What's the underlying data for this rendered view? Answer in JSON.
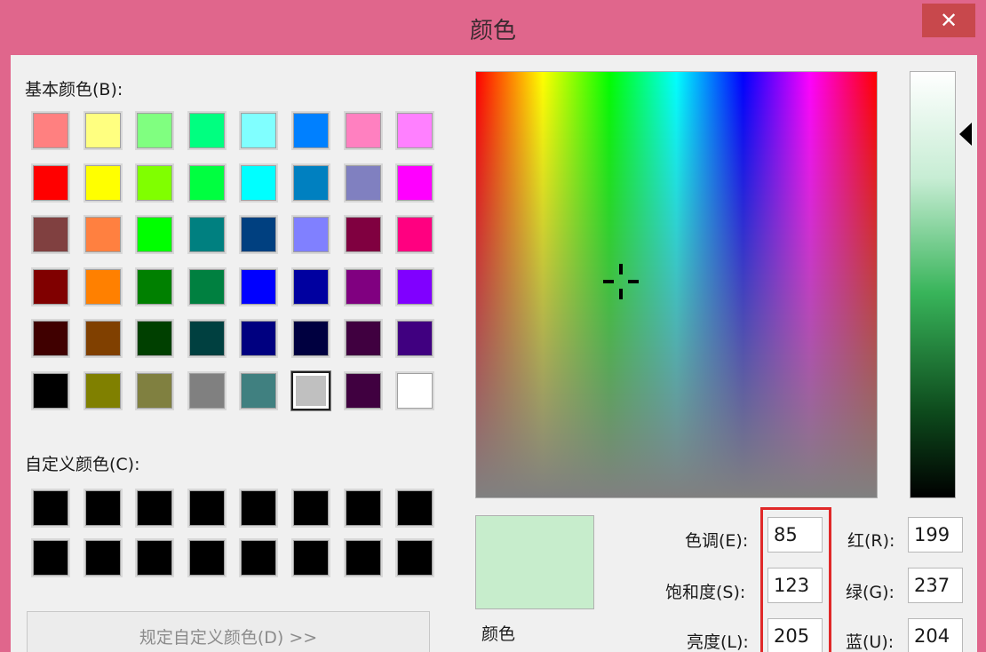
{
  "window": {
    "title": "颜色",
    "close_symbol": "✕"
  },
  "basic_colors": {
    "label": "基本颜色(B):",
    "swatches": [
      "#ff8080",
      "#ffff80",
      "#80ff80",
      "#00ff80",
      "#80ffff",
      "#0080ff",
      "#ff80c0",
      "#ff80ff",
      "#ff0000",
      "#ffff00",
      "#80ff00",
      "#00ff40",
      "#00ffff",
      "#0080c0",
      "#8080c0",
      "#ff00ff",
      "#804040",
      "#ff8040",
      "#00ff00",
      "#008080",
      "#004080",
      "#8080ff",
      "#800040",
      "#ff0080",
      "#800000",
      "#ff8000",
      "#008000",
      "#008040",
      "#0000ff",
      "#0000a0",
      "#800080",
      "#8000ff",
      "#400000",
      "#804000",
      "#004000",
      "#004040",
      "#000080",
      "#000040",
      "#400040",
      "#400080",
      "#000000",
      "#808000",
      "#808040",
      "#808080",
      "#408080",
      "#c0c0c0",
      "#400040",
      "#ffffff"
    ],
    "selected_index": 45
  },
  "custom_colors": {
    "label": "自定义颜色(C):",
    "swatches": [
      "#000000",
      "#000000",
      "#000000",
      "#000000",
      "#000000",
      "#000000",
      "#000000",
      "#000000",
      "#000000",
      "#000000",
      "#000000",
      "#000000",
      "#000000",
      "#000000",
      "#000000",
      "#000000"
    ]
  },
  "define_button": {
    "label": "规定自定义颜色(D) >>"
  },
  "preview": {
    "label": "颜色",
    "color": "#c7edcc"
  },
  "fields": {
    "hue": {
      "label": "色调(E):",
      "value": "85"
    },
    "saturation": {
      "label": "饱和度(S):",
      "value": "123"
    },
    "luminance": {
      "label": "亮度(L):",
      "value": "205"
    },
    "red": {
      "label": "红(R):",
      "value": "199"
    },
    "green": {
      "label": "绿(G):",
      "value": "237"
    },
    "blue": {
      "label": "蓝(U):",
      "value": "204"
    }
  }
}
